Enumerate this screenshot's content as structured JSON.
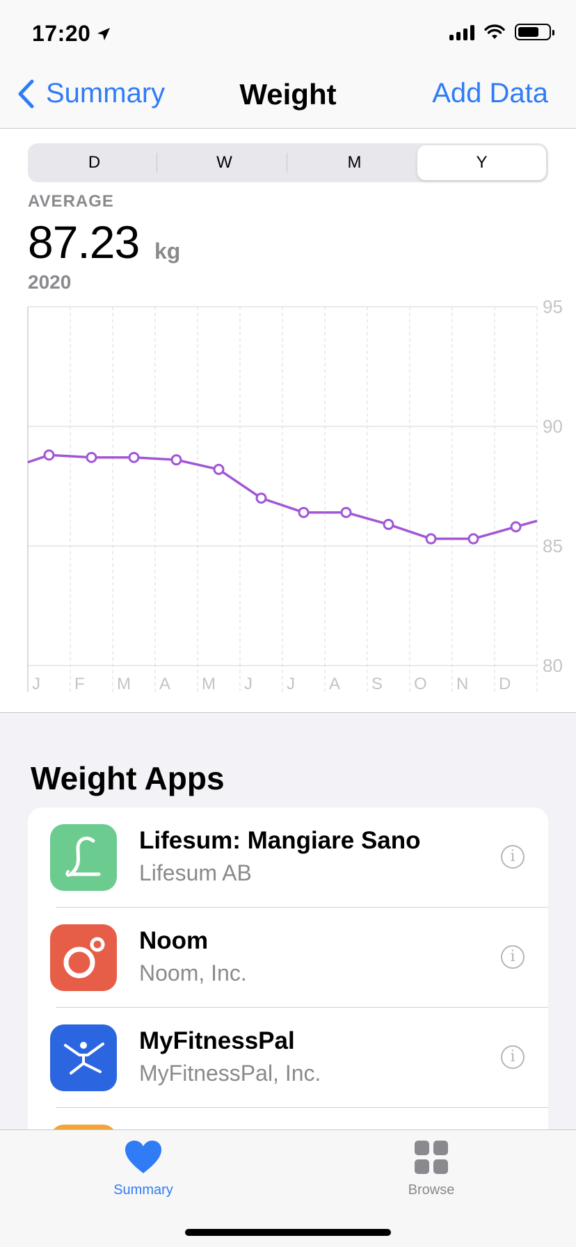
{
  "status": {
    "time": "17:20"
  },
  "nav": {
    "back_label": "Summary",
    "title": "Weight",
    "action_label": "Add Data"
  },
  "segments": [
    "D",
    "W",
    "M",
    "Y"
  ],
  "selected_segment": "Y",
  "summary": {
    "label": "AVERAGE",
    "value": "87.23",
    "unit": "kg",
    "period": "2020"
  },
  "chart_data": {
    "type": "line",
    "categories": [
      "J",
      "F",
      "M",
      "A",
      "M",
      "J",
      "J",
      "A",
      "S",
      "O",
      "N",
      "D"
    ],
    "series": [
      {
        "values": [
          88.8,
          88.7,
          88.7,
          88.6,
          88.2,
          87.0,
          86.4,
          86.4,
          85.9,
          85.3,
          85.3,
          85.8
        ]
      }
    ],
    "y_ticks": [
      95,
      90,
      85,
      80
    ],
    "ylim": [
      80,
      95
    ],
    "grid": true,
    "color": "#a256d6"
  },
  "apps_section": {
    "title": "Weight Apps",
    "apps": [
      {
        "name": "Lifesum: Mangiare Sano",
        "developer": "Lifesum AB",
        "icon": "lifesum-icon",
        "color": "#6ccb8f"
      },
      {
        "name": "Noom",
        "developer": "Noom, Inc.",
        "icon": "noom-icon",
        "color": "#e75e48"
      },
      {
        "name": "MyFitnessPal",
        "developer": "MyFitnessPal, Inc.",
        "icon": "myfitnesspal-icon",
        "color": "#2b66e0"
      },
      {
        "name": "",
        "developer": "",
        "icon": "app-icon",
        "color": "#f2a33a"
      }
    ]
  },
  "tabbar": {
    "tabs": [
      {
        "label": "Summary",
        "icon": "heart-icon",
        "active": true
      },
      {
        "label": "Browse",
        "icon": "grid-icon",
        "active": false
      }
    ],
    "active_color": "#2f7cf6",
    "inactive_color": "#8a8a8e"
  }
}
